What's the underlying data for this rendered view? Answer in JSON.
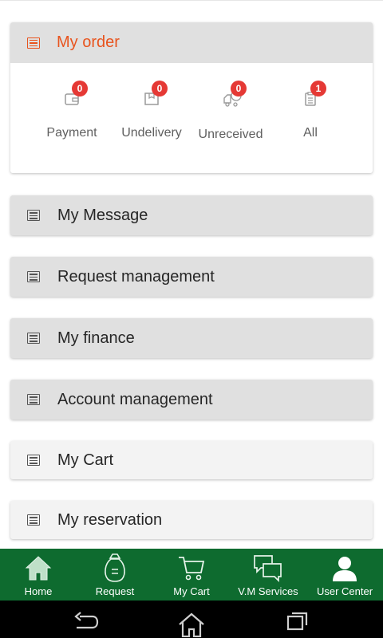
{
  "order": {
    "title": "My order",
    "items": [
      {
        "label": "Payment",
        "badge": "0",
        "icon": "wallet-icon"
      },
      {
        "label": "Undelivery",
        "badge": "0",
        "icon": "package-icon"
      },
      {
        "label": "Unreceived",
        "badge": "0",
        "icon": "truck-icon"
      },
      {
        "label": "All",
        "badge": "1",
        "icon": "clipboard-icon"
      }
    ]
  },
  "menu": [
    {
      "label": "My Message"
    },
    {
      "label": "Request management"
    },
    {
      "label": "My finance"
    },
    {
      "label": "Account management"
    },
    {
      "label": "My Cart"
    },
    {
      "label": "My reservation"
    }
  ],
  "bottom_nav": [
    {
      "label": "Home",
      "icon": "home-icon"
    },
    {
      "label": "Request",
      "icon": "money-bag-icon"
    },
    {
      "label": "My Cart",
      "icon": "cart-icon"
    },
    {
      "label": "V.M Services",
      "icon": "chat-icon"
    },
    {
      "label": "User Center",
      "icon": "user-icon",
      "active": true
    }
  ],
  "colors": {
    "accent": "#e8541e",
    "nav_bg": "#0e6b2f",
    "badge": "#e53935"
  }
}
